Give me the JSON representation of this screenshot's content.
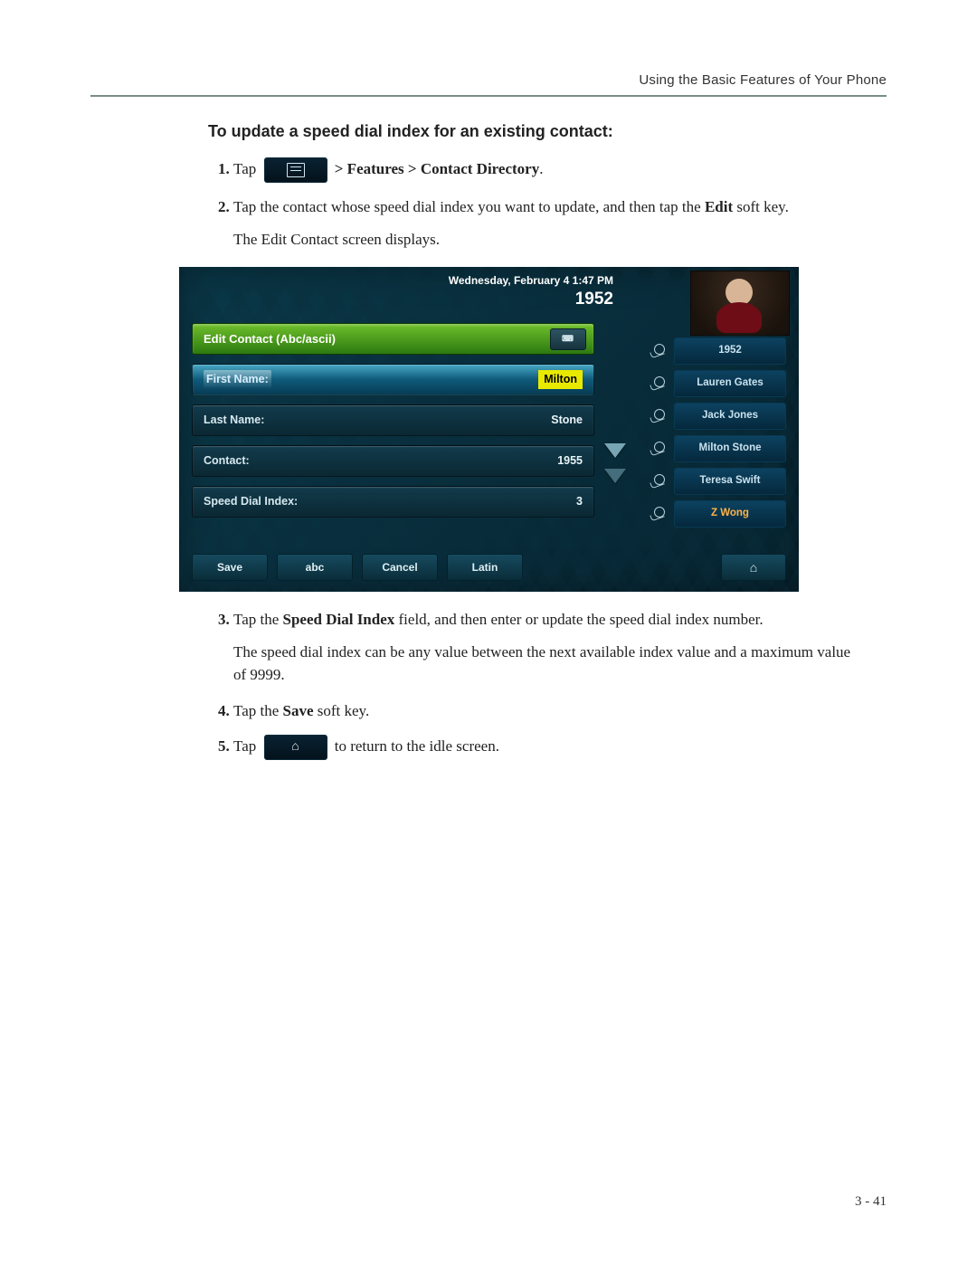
{
  "header": {
    "chapter": "Using the Basic Features of Your Phone"
  },
  "section": {
    "title": "To update a speed dial index for an existing contact:"
  },
  "steps": {
    "s1": {
      "tap": "Tap",
      "path": "> Features > Contact Directory",
      "dot": "."
    },
    "s2": {
      "line1a": "Tap the contact whose speed dial index you want to update, and then tap the ",
      "bold1": "Edit",
      "line1b": " soft key.",
      "line2": "The Edit Contact screen displays."
    },
    "s3": {
      "a": "Tap the ",
      "bold": "Speed Dial Index",
      "b": " field, and then enter or update the speed dial index number.",
      "p2": "The speed dial index can be any value between the next available index value and a maximum value of 9999."
    },
    "s4": {
      "a": "Tap the ",
      "bold": "Save",
      "b": " soft key."
    },
    "s5": {
      "a": "Tap",
      "b": "to return to the idle screen."
    }
  },
  "phone": {
    "datetime": "Wednesday, February 4  1:47 PM",
    "extension": "1952",
    "screenTitle": "Edit Contact (Abc/ascii)",
    "fields": {
      "firstName": {
        "label": "First Name:",
        "value": "Milton"
      },
      "lastName": {
        "label": "Last Name:",
        "value": "Stone"
      },
      "contact": {
        "label": "Contact:",
        "value": "1955"
      },
      "speedDial": {
        "label": "Speed Dial Index:",
        "value": "3"
      }
    },
    "speedDials": [
      {
        "label": "1952",
        "highlight": false
      },
      {
        "label": "Lauren Gates",
        "highlight": false
      },
      {
        "label": "Jack Jones",
        "highlight": false
      },
      {
        "label": "Milton Stone",
        "highlight": false
      },
      {
        "label": "Teresa Swift",
        "highlight": false
      },
      {
        "label": "Z Wong",
        "highlight": true
      }
    ],
    "softkeys": {
      "save": "Save",
      "abc": "abc",
      "cancel": "Cancel",
      "latin": "Latin"
    }
  },
  "footer": {
    "pagenum": "3 - 41"
  }
}
